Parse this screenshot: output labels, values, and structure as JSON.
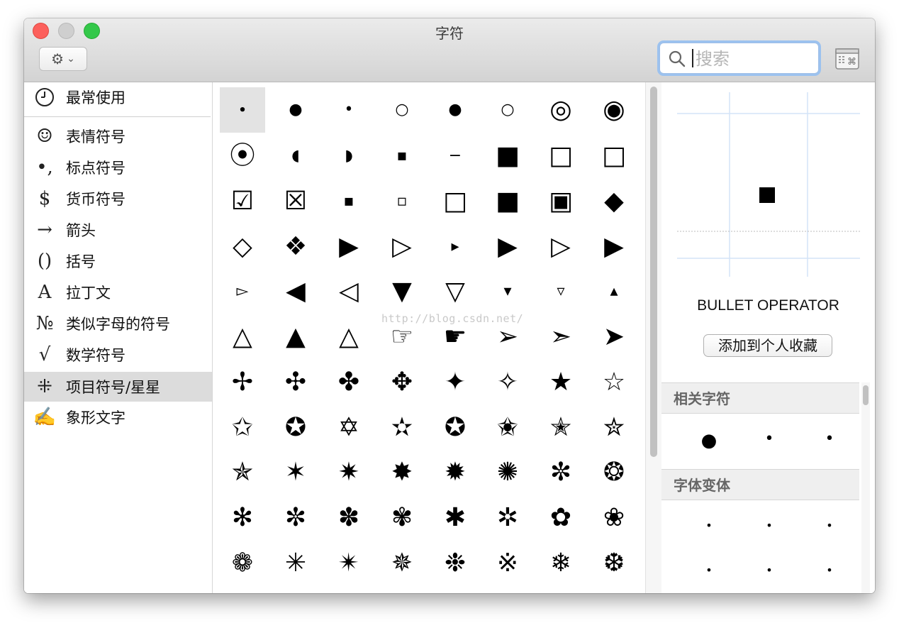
{
  "window": {
    "title": "字符"
  },
  "toolbar": {
    "gear_icon": "gear-icon",
    "search_placeholder": "搜索"
  },
  "sidebar": {
    "items": [
      {
        "label": "最常使用",
        "icon": "clock-icon",
        "glyph": ""
      },
      {
        "label": "表情符号",
        "icon": "smiley-icon",
        "glyph": "☺"
      },
      {
        "label": "标点符号",
        "icon": "punctuation-icon",
        "glyph": "•,"
      },
      {
        "label": "货币符号",
        "icon": "dollar-icon",
        "glyph": "$"
      },
      {
        "label": "箭头",
        "icon": "arrow-icon",
        "glyph": "→"
      },
      {
        "label": "括号",
        "icon": "parentheses-icon",
        "glyph": "()"
      },
      {
        "label": "拉丁文",
        "icon": "latin-a-icon",
        "glyph": "A"
      },
      {
        "label": "类似字母的符号",
        "icon": "numero-icon",
        "glyph": "№"
      },
      {
        "label": "数学符号",
        "icon": "sqrt-icon",
        "glyph": "√"
      },
      {
        "label": "项目符号/星星",
        "icon": "asterisk-star-icon",
        "glyph": "⁜"
      },
      {
        "label": "象形文字",
        "icon": "writing-hand-icon",
        "glyph": "✍"
      }
    ],
    "selected_index": 9
  },
  "grid": {
    "glyphs": [
      [
        "∙",
        "●",
        "•",
        "○",
        "●",
        "○",
        "◎",
        "◉"
      ],
      [
        "⦿",
        "◖",
        "◗",
        "▪",
        "−",
        "■",
        "□",
        "□"
      ],
      [
        "☑",
        "☒",
        "▪",
        "▫",
        "□",
        "■",
        "▣",
        "◆"
      ],
      [
        "◇",
        "❖",
        "▶",
        "▷",
        "▸",
        "▶",
        "▷",
        "▶"
      ],
      [
        "▻",
        "◀",
        "◁",
        "▼",
        "▽",
        "▾",
        "▿",
        "▴"
      ],
      [
        "△",
        "▲",
        "△",
        "☞",
        "☛",
        "➢",
        "➣",
        "➤"
      ],
      [
        "✢",
        "✣",
        "✤",
        "✥",
        "✦",
        "✧",
        "★",
        "☆"
      ],
      [
        "✩",
        "✪",
        "✡",
        "✫",
        "✪",
        "✬",
        "✭",
        "✮"
      ],
      [
        "✯",
        "✶",
        "✷",
        "✸",
        "✹",
        "✺",
        "✼",
        "❂"
      ],
      [
        "✻",
        "✼",
        "✽",
        "✾",
        "✱",
        "✲",
        "✿",
        "❀"
      ],
      [
        "❁",
        "✳",
        "✴",
        "✵",
        "❉",
        "※",
        "❄",
        "❆"
      ]
    ],
    "selected_index": 0
  },
  "inspector": {
    "char_name": "BULLET OPERATOR",
    "add_favorite_label": "添加到个人收藏",
    "related_title": "相关字符",
    "related": [
      "●",
      "•",
      "•"
    ],
    "variants_title": "字体变体",
    "variants": [
      "•",
      "•",
      "•",
      "•",
      "•",
      "•"
    ]
  },
  "watermark": "http://blog.csdn.net/"
}
